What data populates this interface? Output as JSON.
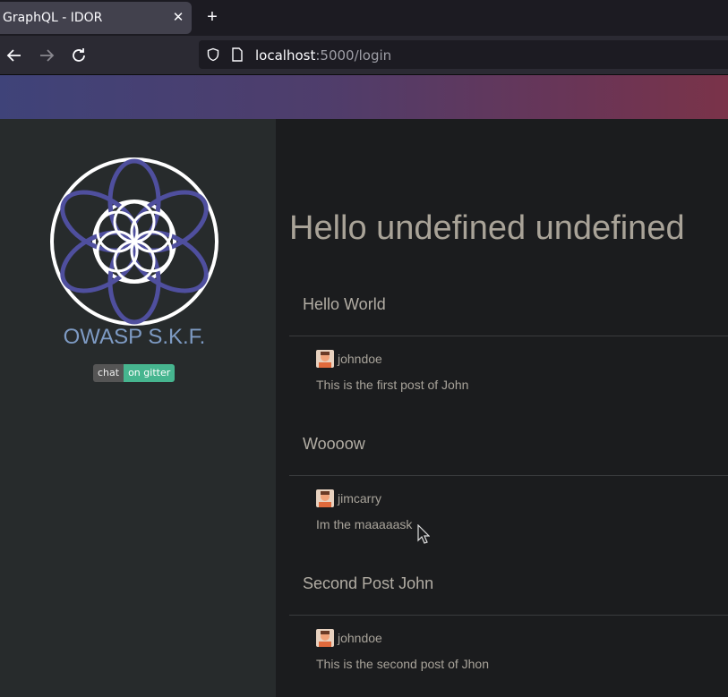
{
  "browser": {
    "tab_title": "GraphQL - IDOR",
    "url_host": "localhost",
    "url_rest": ":5000/login"
  },
  "sidebar": {
    "brand": "OWASP S.K.F.",
    "badge_left": "chat",
    "badge_right": "on gitter"
  },
  "main": {
    "greeting": "Hello undefined undefined",
    "posts": [
      {
        "title": "Hello World",
        "author": "johndoe",
        "body": "This is the first post of John"
      },
      {
        "title": "Woooow",
        "author": "jimcarry",
        "body": "Im the maaaaask"
      },
      {
        "title": "Second Post John",
        "author": "johndoe",
        "body": "This is the second post of Jhon"
      }
    ]
  },
  "colors": {
    "accent_purple": "#4f4f9e",
    "badge_green": "#46b58f"
  }
}
